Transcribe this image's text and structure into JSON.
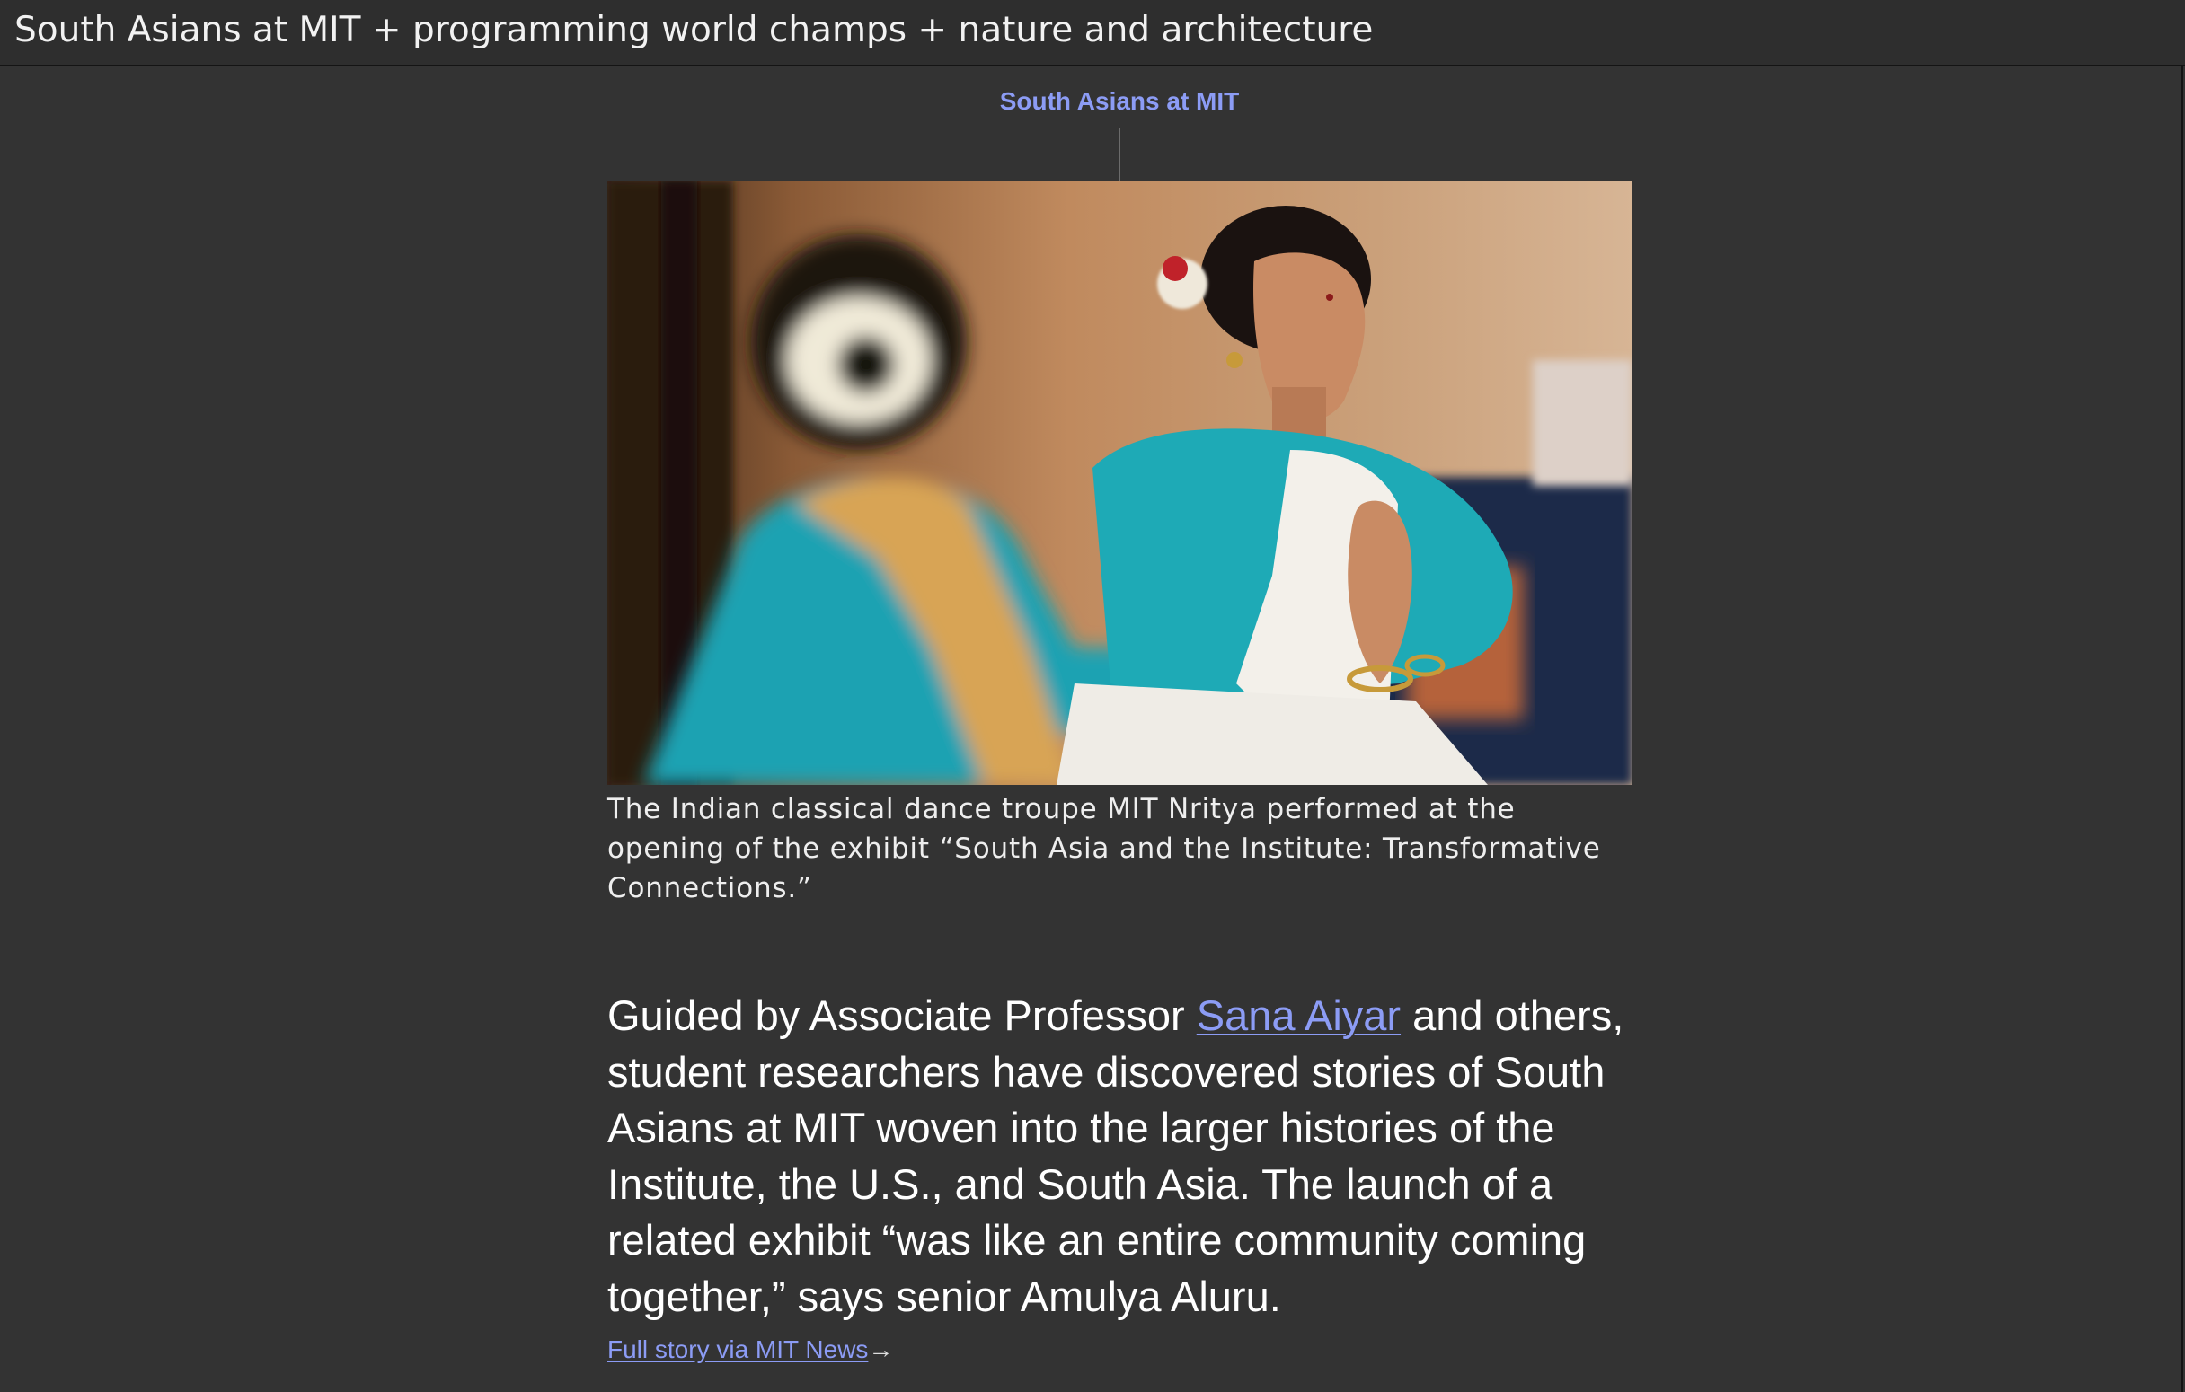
{
  "window": {
    "title": "South Asians at MIT + programming world champs + nature and architecture"
  },
  "section": {
    "link_label": "South Asians at MIT"
  },
  "photo": {
    "icon": "photo-dancers-image",
    "caption": "The Indian classical dance troupe MIT Nritya performed at the opening of the exhibit “South Asia and the Institute: Transformative Connections.”"
  },
  "article": {
    "lede_before": "Guided by Associate Professor ",
    "lede_link": "Sana Aiyar",
    "lede_after": " and others, student researchers have discovered stories of South Asians at MIT woven into the larger histories of the Institute, the U.S., and South Asia. The launch of a related exhibit “was like an entire community coming together,” says senior Amulya Aluru.",
    "full_story_label": "Full story via MIT News",
    "full_story_arrow": "→"
  },
  "colors": {
    "background": "#333333",
    "titlebar": "#2e2e2e",
    "link": "#8c9cf5",
    "text": "#ffffff"
  }
}
